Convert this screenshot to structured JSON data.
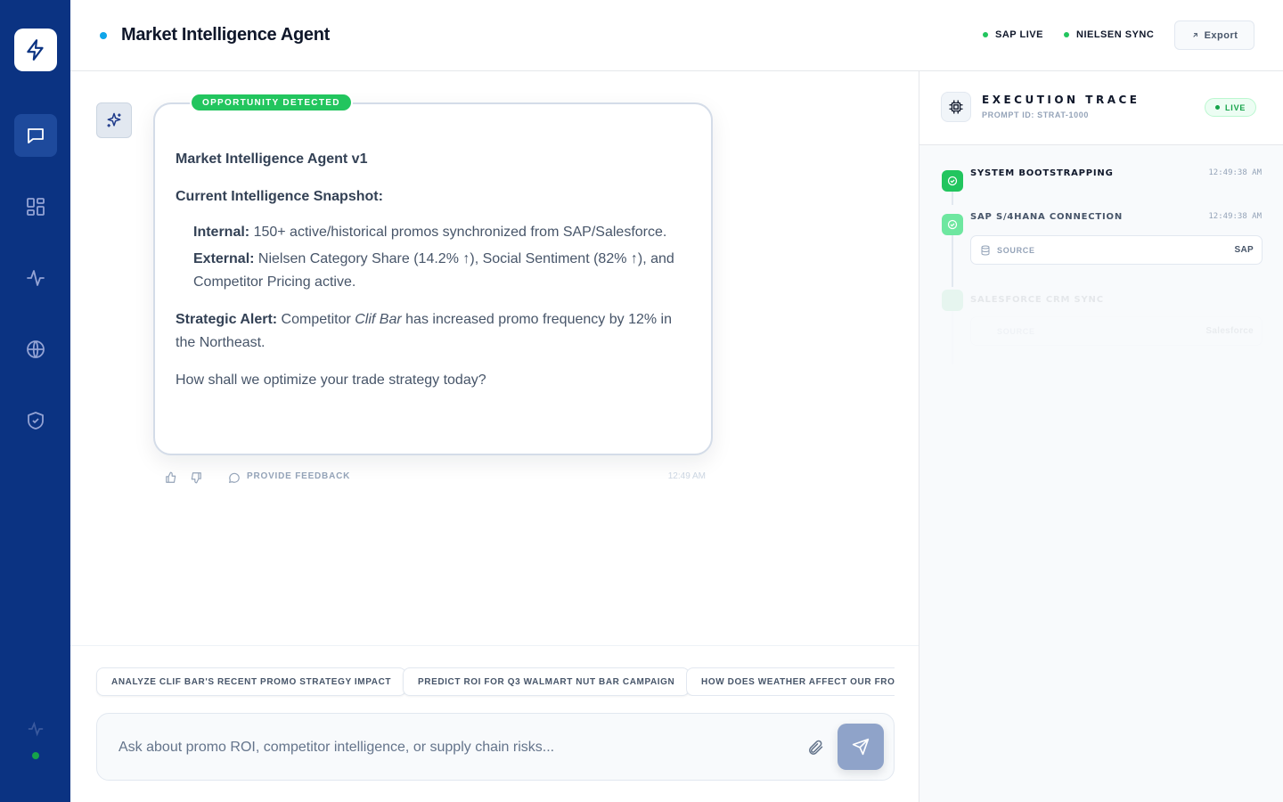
{
  "header": {
    "title": "Market Intelligence Agent",
    "statuses": [
      {
        "label": "SAP LIVE"
      },
      {
        "label": "NIELSEN SYNC"
      }
    ],
    "export_label": "Export"
  },
  "sidebar": {
    "items": [
      {
        "name": "chat",
        "icon": "message-square-icon",
        "active": true
      },
      {
        "name": "dashboard",
        "icon": "layout-grid-icon",
        "active": false
      },
      {
        "name": "analytics",
        "icon": "activity-icon",
        "active": false
      },
      {
        "name": "market",
        "icon": "globe-icon",
        "active": false
      },
      {
        "name": "security",
        "icon": "shield-check-icon",
        "active": false
      }
    ]
  },
  "message": {
    "badge": "OPPORTUNITY DETECTED",
    "title": "Market Intelligence Agent v1",
    "snapshot_heading": "Current Intelligence Snapshot:",
    "internal_label": "Internal:",
    "internal_text": " 150+ active/historical promos synchronized from SAP/Salesforce.",
    "external_label": "External:",
    "external_text": " Nielsen Category Share (14.2% ↑), Social Sentiment (82% ↑), and Competitor Pricing active.",
    "alert_label": "Strategic Alert:",
    "alert_text_1": " Competitor ",
    "alert_brand": "Clif Bar",
    "alert_text_2": " has increased promo frequency by 12% in the Northeast.",
    "question": "How shall we optimize your trade strategy today?",
    "feedback_label": "PROVIDE FEEDBACK",
    "time": "12:49 AM"
  },
  "suggestions": [
    "ANALYZE CLIF BAR'S RECENT PROMO STRATEGY IMPACT",
    "PREDICT ROI FOR Q3 WALMART NUT BAR CAMPAIGN",
    "HOW DOES WEATHER AFFECT OUR FROZE"
  ],
  "input": {
    "placeholder": "Ask about promo ROI, competitor intelligence, or supply chain risks...",
    "value": ""
  },
  "trace": {
    "title": "EXECUTION TRACE",
    "prompt_id": "PROMPT ID: STRAT-1000",
    "live_label": "LIVE",
    "steps": [
      {
        "title": "SYSTEM BOOTSTRAPPING",
        "time": "12:49:38 AM",
        "status": "done"
      },
      {
        "title": "SAP S/4HANA CONNECTION",
        "time": "12:49:38 AM",
        "status": "done",
        "source_label": "SOURCE",
        "source_value": "SAP"
      },
      {
        "title": "SALESFORCE CRM SYNC",
        "time": "",
        "status": "pending",
        "source_label": "SOURCE",
        "source_value": "Salesforce"
      }
    ]
  },
  "colors": {
    "sidebar": "#0b3382",
    "accent_green": "#22c55e",
    "accent_blue": "#0ea5e9"
  }
}
